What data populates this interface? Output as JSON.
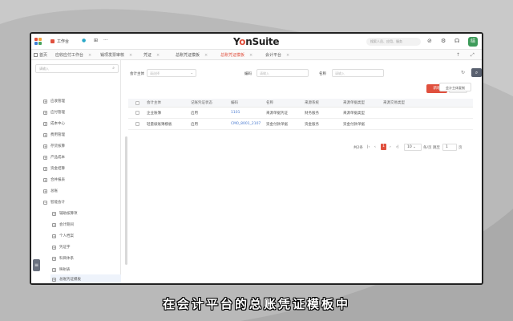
{
  "topbar": {
    "workbench_label": "工作台",
    "brand_prefix": "Y",
    "brand_o": "o",
    "brand_suffix": "nSuite",
    "search_placeholder": "搜索人员、应用、服务",
    "avatar_text": "结"
  },
  "tabs": [
    {
      "label": "首页"
    },
    {
      "label": "应收应付工作台"
    },
    {
      "label": "销项发票审核"
    },
    {
      "label": "凭证"
    },
    {
      "label": "总账凭证模板"
    },
    {
      "label": "总账凭证模板"
    },
    {
      "label": "会计平台"
    }
  ],
  "sidebar": {
    "search_placeholder": "请输入",
    "items": [
      {
        "label": "应收管理",
        "toggle": "+"
      },
      {
        "label": "应付管理",
        "toggle": "+"
      },
      {
        "label": "成本中心",
        "toggle": "+"
      },
      {
        "label": "费用管理",
        "toggle": "+"
      },
      {
        "label": "存货核算",
        "toggle": "+"
      },
      {
        "label": "产品成本",
        "toggle": "+"
      },
      {
        "label": "资金结算",
        "toggle": "+"
      },
      {
        "label": "合并报表",
        "toggle": "+"
      },
      {
        "label": "总账",
        "toggle": "+"
      },
      {
        "label": "智能会计",
        "toggle": "−"
      },
      {
        "label": "辅助核算项",
        "toggle": "+"
      },
      {
        "label": "会计期间",
        "toggle": "+"
      },
      {
        "label": "个人档案",
        "toggle": "+"
      },
      {
        "label": "凭证字",
        "toggle": "+"
      },
      {
        "label": "科目体系",
        "toggle": "+"
      },
      {
        "label": "映射表",
        "toggle": "+"
      },
      {
        "label": "来源表",
        "toggle": "+"
      },
      {
        "label": "总账凭证模板",
        "toggle": "+"
      }
    ]
  },
  "filters": {
    "accounting_entity_label": "会计主体",
    "accounting_entity_placeholder": "请选择",
    "code_label": "编码",
    "code_placeholder": "请输入",
    "name_label": "名称",
    "name_placeholder": "请输入"
  },
  "actions": {
    "add_label": "新增",
    "delete_label": "删除",
    "copy_label": "会计主体复制"
  },
  "table": {
    "columns": [
      "会计主体",
      "记账凭证状态",
      "编码",
      "名称",
      "来源系统",
      "来源单据类型",
      "来源交易类型"
    ],
    "rows": [
      [
        "企业账簿",
        "启用",
        "1101",
        "来源单据凭证",
        "财务服务",
        "来源单据类型",
        ""
      ],
      [
        "轻量级账簿模板",
        "启用",
        "CM0_8001_2107",
        "资金付款单据",
        "资金服务",
        "资金付款单据",
        ""
      ]
    ]
  },
  "pagination": {
    "total_text": "共2条",
    "current_page": "1",
    "page_size": "10",
    "per_page_suffix": "条/页",
    "goto_label": "跳至",
    "goto_value": "1",
    "page_suffix": "页"
  },
  "subtitle": "在会计平台的总账凭证模板中"
}
